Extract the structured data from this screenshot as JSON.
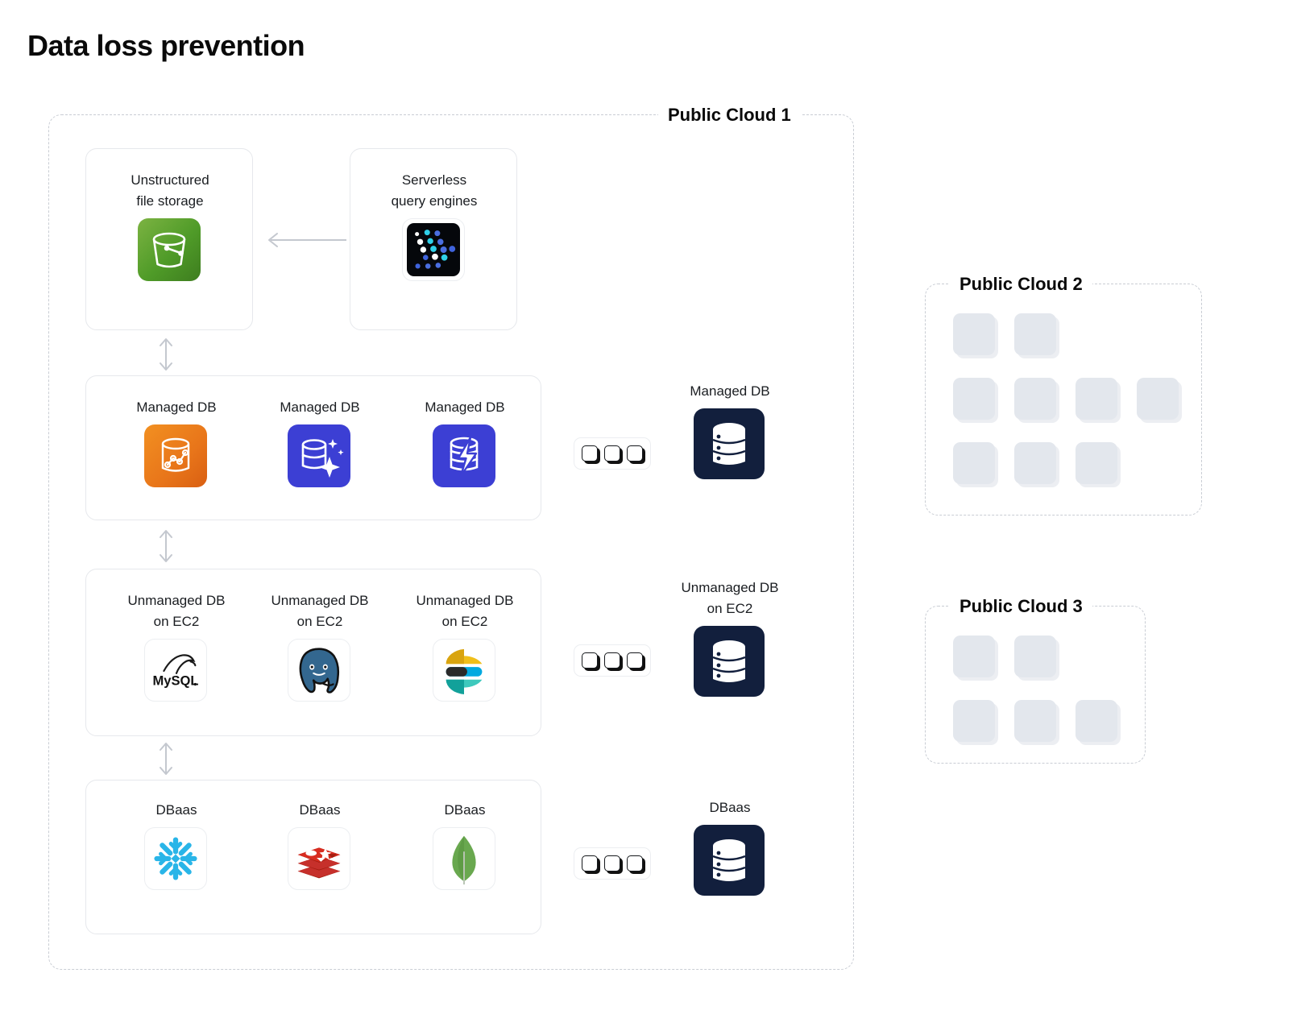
{
  "page": {
    "title": "Data loss prevention",
    "background": "#ffffff"
  },
  "colors": {
    "title": "#0a0a0a",
    "dashed_border": "#c9cdd4",
    "card_border": "#e6e8ec",
    "dark_tile": "#121f3d",
    "placeholder": "#e3e7ed",
    "arrow": "#c4c8cf",
    "s3_green": "#4f9b28",
    "redshift_orange": "#e8871f",
    "azure_blue": "#3c3fd4",
    "mysql_blue": "#00618a",
    "postgres_blue": "#33678f",
    "elastic_yellow": "#f0bf1a",
    "elastic_cyan": "#00bfb3",
    "elastic_teal": "#0ebcae",
    "snowflake_blue": "#29b5e8",
    "redis_red": "#c6302b",
    "mongo_green": "#69a84f"
  },
  "regions": [
    {
      "id": "cloud1",
      "label": "Public Cloud 1"
    },
    {
      "id": "cloud2",
      "label": "Public Cloud 2"
    },
    {
      "id": "cloud3",
      "label": "Public Cloud 3"
    }
  ],
  "cards": {
    "unstructured": {
      "label": "Unstructured\nfile storage",
      "icon": "s3-bucket-icon"
    },
    "serverless": {
      "label": "Serverless\nquery engines",
      "icon": "athena-dots-icon"
    },
    "managed_row": {
      "tiles": [
        {
          "label": "Managed DB",
          "icon": "redshift-icon"
        },
        {
          "label": "Managed DB",
          "icon": "azure-sql-sparkle-icon"
        },
        {
          "label": "Managed DB",
          "icon": "aurora-bolt-icon"
        }
      ]
    },
    "unmanaged_row": {
      "tiles": [
        {
          "label": "Unmanaged DB\non EC2",
          "icon": "mysql-icon"
        },
        {
          "label": "Unmanaged DB\non EC2",
          "icon": "postgresql-icon"
        },
        {
          "label": "Unmanaged DB\non EC2",
          "icon": "elasticsearch-icon"
        }
      ]
    },
    "dbaas_row": {
      "tiles": [
        {
          "label": "DBaas",
          "icon": "snowflake-icon"
        },
        {
          "label": "DBaas",
          "icon": "redis-icon"
        },
        {
          "label": "DBaas",
          "icon": "mongodb-icon"
        }
      ]
    }
  },
  "side_tiles": [
    {
      "label": "Managed DB",
      "icon": "database-stack-icon"
    },
    {
      "label": "Unmanaged DB\non EC2",
      "icon": "database-stack-icon"
    },
    {
      "label": "DBaas",
      "icon": "database-stack-icon"
    }
  ],
  "minibox_groups": [
    {
      "count": 3
    },
    {
      "count": 3
    },
    {
      "count": 3
    }
  ],
  "cloud2_placeholders": {
    "rows": [
      2,
      4,
      3
    ],
    "total": 9
  },
  "cloud3_placeholders": {
    "rows": [
      2,
      3
    ],
    "total": 5
  },
  "connectors": [
    {
      "name": "serverless-to-storage",
      "type": "arrow-left"
    },
    {
      "name": "storage-to-managed",
      "type": "arrow-updown"
    },
    {
      "name": "managed-to-unmanaged",
      "type": "arrow-updown"
    },
    {
      "name": "unmanaged-to-dbaas",
      "type": "arrow-updown"
    }
  ]
}
